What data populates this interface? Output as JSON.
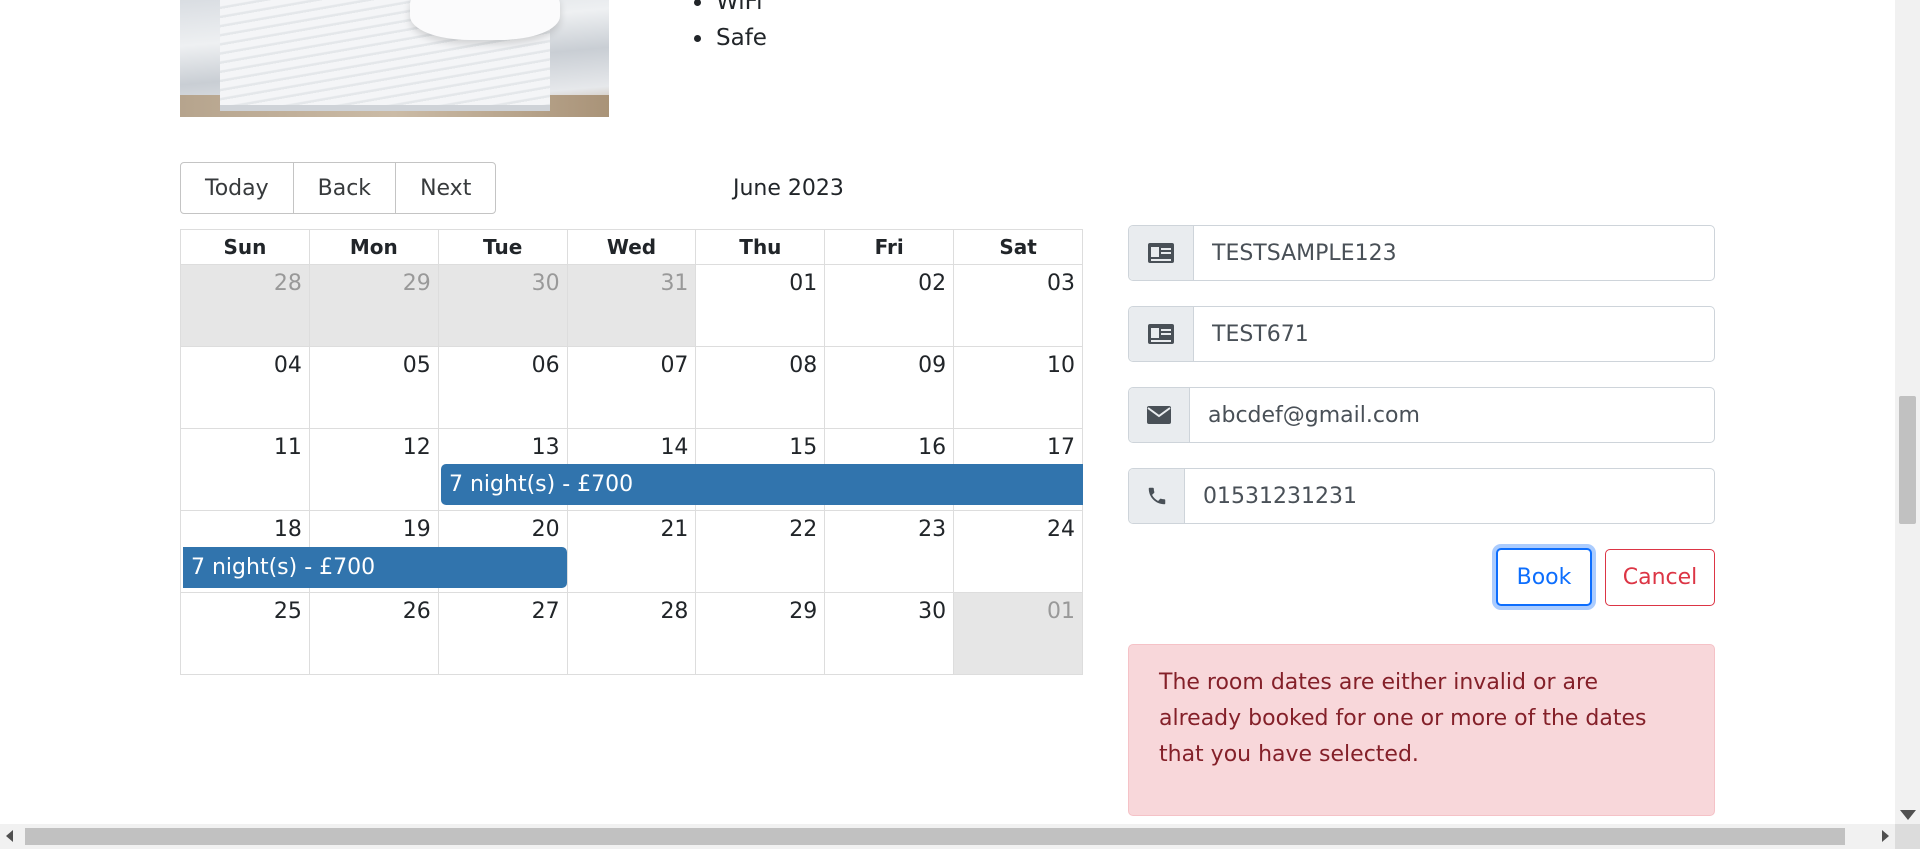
{
  "room": {
    "features": [
      "WiFi",
      "Safe"
    ]
  },
  "calendar": {
    "toolbar": {
      "today": "Today",
      "back": "Back",
      "next": "Next"
    },
    "month_label": "June 2023",
    "weekdays": [
      "Sun",
      "Mon",
      "Tue",
      "Wed",
      "Thu",
      "Fri",
      "Sat"
    ],
    "weeks": [
      [
        "28",
        "29",
        "30",
        "31",
        "01",
        "02",
        "03"
      ],
      [
        "04",
        "05",
        "06",
        "07",
        "08",
        "09",
        "10"
      ],
      [
        "11",
        "12",
        "13",
        "14",
        "15",
        "16",
        "17"
      ],
      [
        "18",
        "19",
        "20",
        "21",
        "22",
        "23",
        "24"
      ],
      [
        "25",
        "26",
        "27",
        "28",
        "29",
        "30",
        "01"
      ]
    ],
    "event_label": "7 night(s) - £700",
    "event_color": "#3174ad"
  },
  "form": {
    "firstname": {
      "value": "TESTSAMPLE123",
      "icon": "id-card-icon"
    },
    "lastname": {
      "value": "TEST671",
      "icon": "id-card-icon"
    },
    "email": {
      "value": "abcdef@gmail.com",
      "icon": "envelope-icon"
    },
    "phone": {
      "value": "01531231231",
      "icon": "phone-icon"
    },
    "book_label": "Book",
    "cancel_label": "Cancel"
  },
  "alert": {
    "message": "The room dates are either invalid or are already booked for one or more of the dates that you have selected."
  }
}
